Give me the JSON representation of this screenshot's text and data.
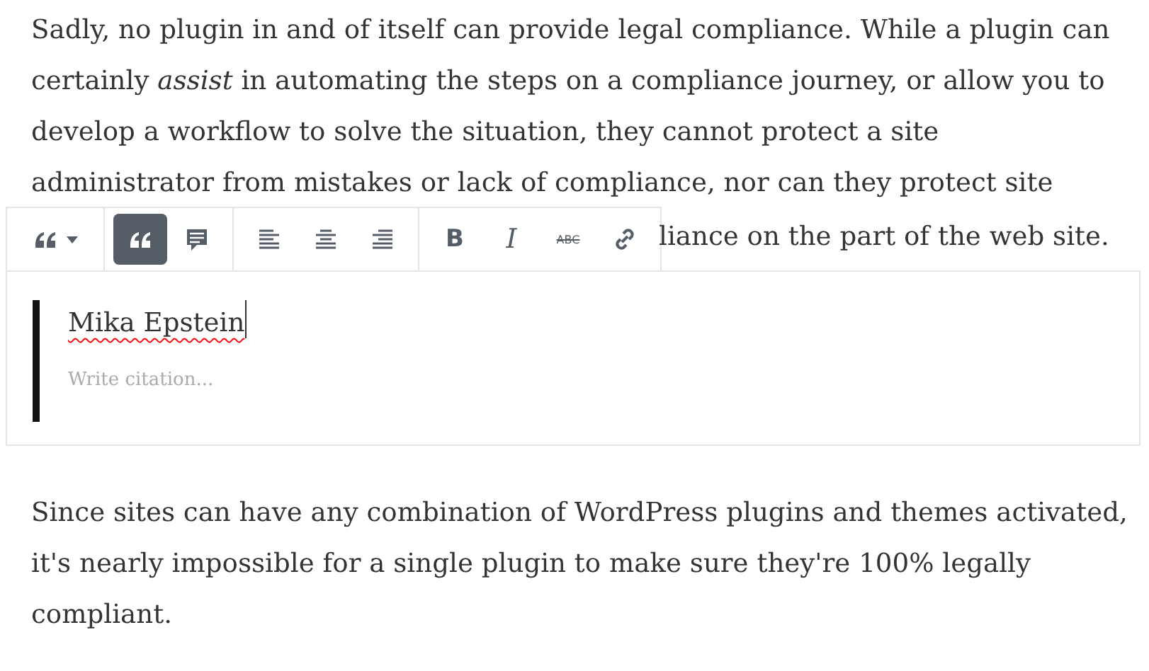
{
  "paragraph_1": "Sadly, no plugin in and of itself can provide legal compliance. While a plugin can certainly *assist* in automating the steps on a compliance journey, or allow you to develop a workflow to solve the situation, they cannot protect a site administrator from mistakes or lack of compliance, nor can they protect site",
  "paragraph_1_visible_end": "liance on the part of the web site.",
  "toolbar": {
    "groups": [
      [
        {
          "kind": "quote-style",
          "selected": false
        }
      ],
      [
        {
          "kind": "quote",
          "selected": true
        },
        {
          "kind": "comment",
          "selected": false
        }
      ],
      [
        {
          "kind": "align-left",
          "selected": false
        },
        {
          "kind": "align-center",
          "selected": false
        },
        {
          "kind": "align-right",
          "selected": false
        }
      ],
      [
        {
          "kind": "bold",
          "label": "B",
          "selected": false
        },
        {
          "kind": "italic",
          "label": "I",
          "selected": false
        },
        {
          "kind": "strikethrough",
          "label": "ABC",
          "selected": false
        },
        {
          "kind": "link",
          "selected": false
        }
      ]
    ]
  },
  "quote_block": {
    "quote": "Mika Epstein",
    "citation": {
      "placeholder": "Write citation..."
    }
  },
  "paragraph_2": "Since sites can have any combination of WordPress plugins and themes activated, it's nearly impossible for a single plugin to make sure they're 100% legally compliant."
}
